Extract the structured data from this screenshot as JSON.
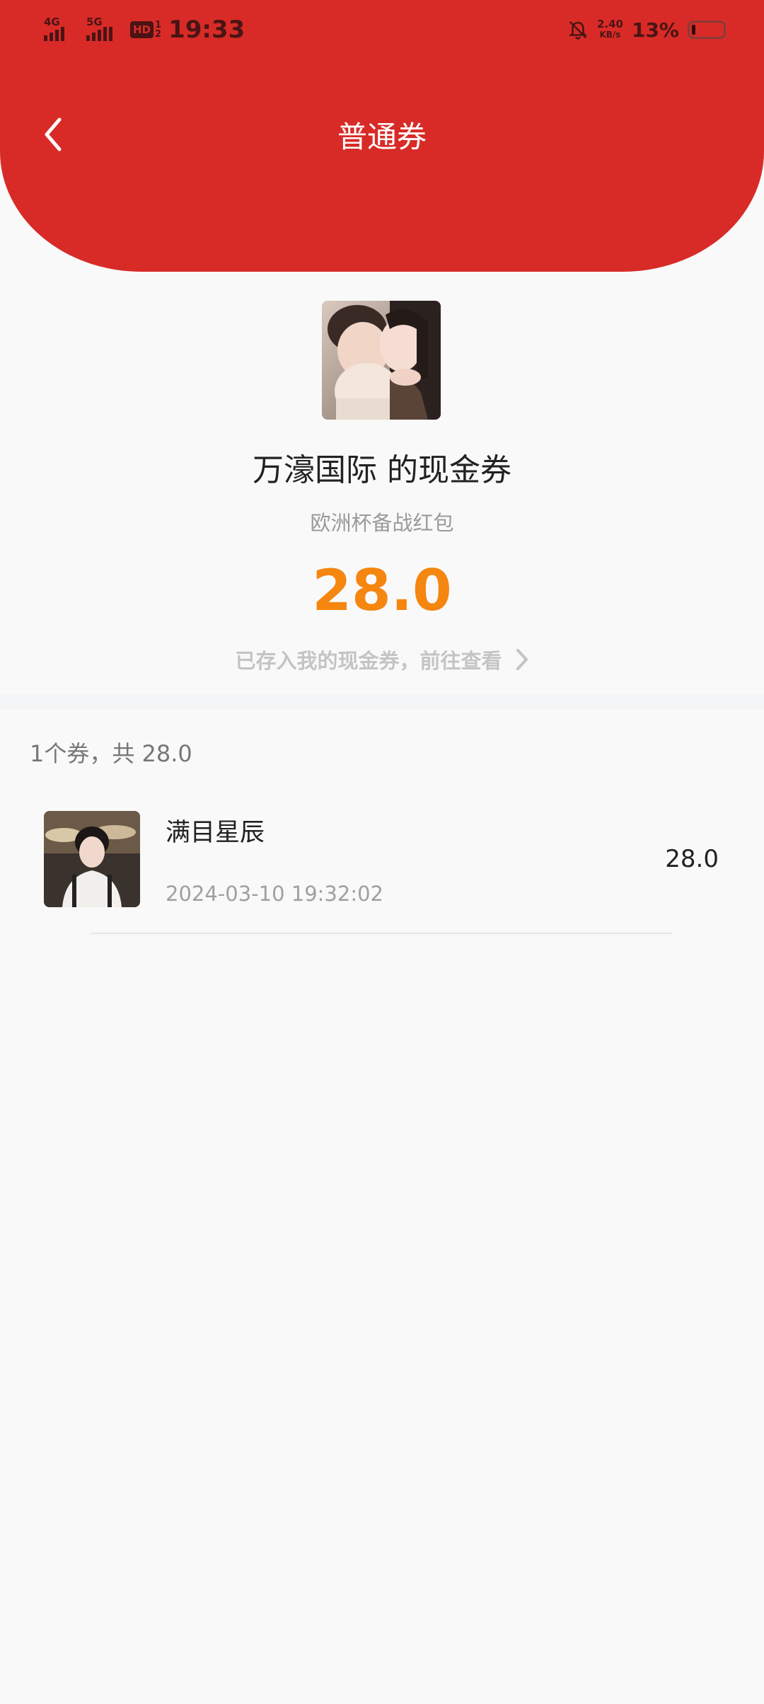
{
  "status_bar": {
    "network_1": "4G",
    "network_2": "5G",
    "hd_label": "HD",
    "hd_sub_top": "1",
    "hd_sub_bottom": "2",
    "time": "19:33",
    "speed_value": "2.40",
    "speed_unit": "KB/s",
    "battery_pct": "13%",
    "icons": [
      "signal-icon",
      "signal-icon",
      "hd-volte-icon",
      "bell-off-icon",
      "battery-icon"
    ]
  },
  "header": {
    "title": "普通券",
    "back_icon": "chevron-left-icon",
    "bg_color": "#d82b27"
  },
  "coupon": {
    "title": "万濠国际 的现金券",
    "subtitle": "欧洲杯备战红包",
    "amount": "28.0",
    "amount_color": "#f5860f",
    "view_link": "已存入我的现金券，前往查看",
    "view_link_icon": "chevron-right-icon"
  },
  "list": {
    "summary": "1个券，共 28.0",
    "items": [
      {
        "name": "满目星辰",
        "time": "2024-03-10 19:32:02",
        "amount": "28.0"
      }
    ]
  }
}
